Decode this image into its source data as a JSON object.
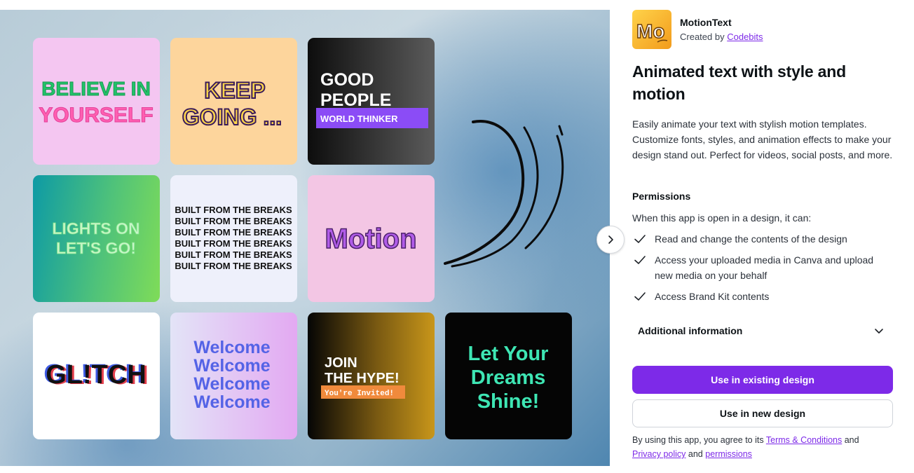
{
  "app": {
    "name": "MotionText",
    "created_by_prefix": "Created by",
    "creator": "Codebits",
    "logo_text": "Mo"
  },
  "headline": "Animated text with style and motion",
  "description": "Easily animate your text with stylish motion templates. Customize fonts, styles, and animation effects to make your design stand out. Perfect for videos, social posts, and more.",
  "permissions": {
    "heading": "Permissions",
    "intro": "When this app is open in a design, it can:",
    "items": [
      "Read and change the contents of the design",
      "Access your uploaded media in Canva and upload new media on your behalf",
      "Access Brand Kit contents"
    ]
  },
  "additional_info_label": "Additional information",
  "buttons": {
    "use_existing": "Use in existing design",
    "use_new": "Use in new design"
  },
  "legal": {
    "prefix": "By using this app, you agree to its",
    "terms": "Terms & Conditions",
    "and1": "and",
    "privacy": "Privacy policy",
    "and2": "and",
    "permissions": "permissions"
  },
  "tiles": {
    "t1": [
      "BELIEVE IN",
      "YOURSELF"
    ],
    "t2": [
      "KEEP",
      "GOING ..."
    ],
    "t3": [
      "GOOD",
      "PEOPLE",
      "WORLD THINKER"
    ],
    "t4": [
      "LIGHTS ON",
      "LET'S GO!"
    ],
    "t5": [
      "BUILT FROM THE BREAKS",
      "BUILT FROM THE BREAKS",
      "BUILT FROM THE BREAKS",
      "BUILT FROM THE BREAKS",
      "BUILT FROM THE BREAKS",
      "BUILT FROM THE BREAKS"
    ],
    "t6": [
      "Motion"
    ],
    "t7": [
      "GL!TCH"
    ],
    "t8": [
      "Welcome",
      "Welcome",
      "Welcome",
      "Welcome"
    ],
    "t9": [
      "JOIN",
      "THE HYPE!",
      "You're Invited!"
    ],
    "t10": [
      "Let Your",
      "Dreams",
      "Shine!"
    ]
  },
  "icons": {
    "next": "chevron-right-icon",
    "check": "check-icon",
    "expand": "chevron-down-icon"
  },
  "colors": {
    "accent": "#7d2ae8",
    "text": "#0d1216"
  }
}
